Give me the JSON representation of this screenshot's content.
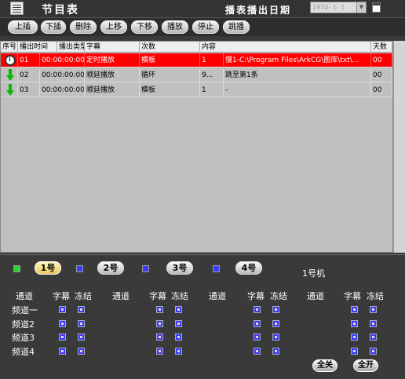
{
  "header": {
    "title": "节目表",
    "date_label": "播表播出日期",
    "date_value": "1970- 1- 1"
  },
  "toolbar": [
    "上插",
    "下插",
    "删除",
    "上移",
    "下移",
    "播放",
    "停止",
    "跳播"
  ],
  "table": {
    "columns": [
      "序号",
      "播出时间",
      "播出类型",
      "字幕",
      "次数",
      "内容",
      "天数"
    ],
    "rows": [
      {
        "icon": "clock-icon",
        "selected": true,
        "cells": [
          "01",
          "00:00:00:00",
          "定时播放",
          "模板",
          "1",
          "慢1-C:\\Program Files\\ArkCG\\图库\\txt\\...",
          "00"
        ]
      },
      {
        "icon": "down-arrow-icon",
        "selected": false,
        "cells": [
          "02",
          "00:00:00:00",
          "顺延播放",
          "循环",
          "9...",
          "跳至第1条",
          "00"
        ]
      },
      {
        "icon": "down-arrow-icon",
        "selected": false,
        "cells": [
          "03",
          "00:00:00:00",
          "顺延播放",
          "模板",
          "1",
          "-",
          "00"
        ]
      }
    ]
  },
  "machine_tabs": [
    "1号",
    "2号",
    "3号",
    "4号"
  ],
  "active_machine": "1号机",
  "channel_grid": {
    "group_headers": [
      {
        "channel": "通道",
        "subtitle": "字幕",
        "freeze": "冻结"
      },
      {
        "channel": "通道",
        "subtitle": "字幕",
        "freeze": "冻结"
      },
      {
        "channel": "通道",
        "subtitle": "字幕",
        "freeze": "冻结"
      },
      {
        "channel": "通道",
        "subtitle": "字幕",
        "freeze": "冻结"
      }
    ],
    "rows": [
      "频道一",
      "频道2",
      "频道3",
      "频道4"
    ]
  },
  "buttons": {
    "close_all": "全关",
    "open_all": "全开"
  },
  "colors": {
    "selected_row": "#ff0000",
    "background": "#3a3a3a",
    "checkbox": "#3a3aff",
    "active_tab": "#e9c95a"
  }
}
